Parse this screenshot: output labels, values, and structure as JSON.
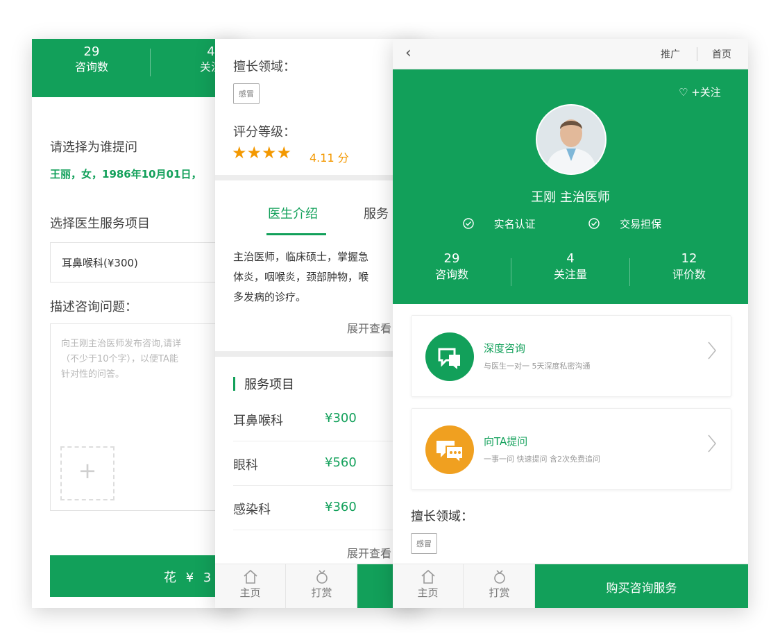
{
  "screen1": {
    "stats": [
      {
        "num": "29",
        "label": "咨询数"
      },
      {
        "num": "4",
        "label": "关注"
      }
    ],
    "ask_for_heading": "请选择为谁提问",
    "patient_info": "王丽，女，1986年10月01日，",
    "service_heading": "选择医生服务项目",
    "selected_service": "耳鼻喉科(¥300)",
    "describe_heading": "描述咨询问题：",
    "placeholder_lines": [
      "向王刚主治医师发布咨询,请详",
      "（不少于10个字），以便TA能",
      "针对性的问答。"
    ],
    "add_icon": "plus-icon",
    "pay_button": "花 ¥ 3 0"
  },
  "screen2": {
    "specialty_label": "擅长领域：",
    "specialty_tag": "感冒",
    "rating_label": "评分等级：",
    "rating_stars": 4,
    "rating_score": "4.11 分",
    "tabs": [
      "医生介绍",
      "服务"
    ],
    "intro_lines": [
      "主治医师，临床硕士，掌握急",
      "体炎，咽喉炎，颈部肿物，喉",
      "多发病的诊疗。"
    ],
    "expand_label": "展开查看",
    "services_title": "服务项目",
    "services": [
      {
        "name": "耳鼻喉科",
        "price": "¥300"
      },
      {
        "name": "眼科",
        "price": "¥560"
      },
      {
        "name": "感染科",
        "price": "¥360"
      }
    ],
    "expand_label_2": "展开查看",
    "tabbar": [
      {
        "label": "主页",
        "icon": "home-icon"
      },
      {
        "label": "打赏",
        "icon": "reward-icon"
      }
    ]
  },
  "screen3": {
    "nav": {
      "back_icon": "back-chevron-icon",
      "promote": "推广",
      "home": "首页"
    },
    "follow": "♡ +关注",
    "doctor_name": "王刚 主治医师",
    "badges": [
      "实名认证",
      "交易担保"
    ],
    "stats": [
      {
        "num": "29",
        "label": "咨询数"
      },
      {
        "num": "4",
        "label": "关注量"
      },
      {
        "num": "12",
        "label": "评价数"
      }
    ],
    "cards": [
      {
        "title": "深度咨询",
        "desc": "与医生一对一 5天深度私密沟通",
        "icon": "chat-bubble-icon",
        "color": "#12a05a"
      },
      {
        "title": "向TA提问",
        "desc": "一事一问 快速提问 含2次免费追问",
        "icon": "speech-bubbles-icon",
        "color": "#f0a020"
      }
    ],
    "specialty_label": "擅长领域：",
    "specialty_tag": "感冒",
    "tabbar": [
      {
        "label": "主页",
        "icon": "home-icon"
      },
      {
        "label": "打赏",
        "icon": "reward-icon"
      }
    ],
    "buy_button": "购买咨询服务"
  },
  "colors": {
    "primary": "#12a05a",
    "accent": "#f39800",
    "orange_card": "#f0a020"
  }
}
